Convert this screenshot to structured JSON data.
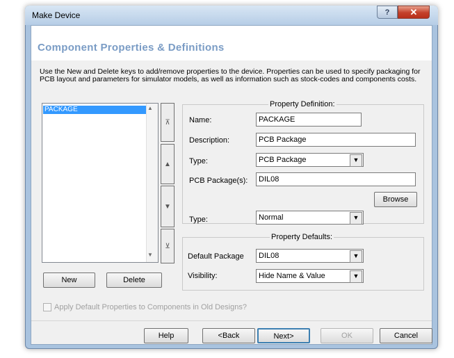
{
  "window": {
    "title": "Make Device",
    "help_glyph": "?",
    "close_glyph": "✕"
  },
  "header": {
    "title": "Component Properties & Definitions"
  },
  "intro": "Use the New and Delete keys to add/remove properties to the device. Properties can be used to specify packaging for PCB layout and parameters for simulator models, as well as information such as stock-codes and components costs.",
  "property_list": {
    "items": [
      "PACKAGE"
    ]
  },
  "side_buttons": {
    "top": "⊼",
    "up": "▲",
    "down": "▼",
    "bottom": "⊻"
  },
  "list_buttons": {
    "new": "New",
    "delete": "Delete"
  },
  "property_definition": {
    "legend": "Property Definition:",
    "name_label": "Name:",
    "name_value": "PACKAGE",
    "description_label": "Description:",
    "description_value": "PCB Package",
    "type_label": "Type:",
    "type_value": "PCB Package",
    "pcb_label": "PCB Package(s):",
    "pcb_value": "DIL08",
    "browse_label": "Browse",
    "type2_label": "Type:",
    "type2_value": "Normal"
  },
  "property_defaults": {
    "legend": "Property Defaults:",
    "default_package_label": "Default Package",
    "default_package_value": "DIL08",
    "visibility_label": "Visibility:",
    "visibility_value": "Hide Name & Value"
  },
  "apply_checkbox": {
    "label": "Apply Default Properties to Components in Old Designs?",
    "checked": false
  },
  "footer": {
    "help": "Help",
    "back": "<Back",
    "next": "Next>",
    "ok": "OK",
    "cancel": "Cancel"
  },
  "colors": {
    "header_title": "#7a9cc5",
    "selection": "#3399ff",
    "close_button": "#c4402a"
  }
}
